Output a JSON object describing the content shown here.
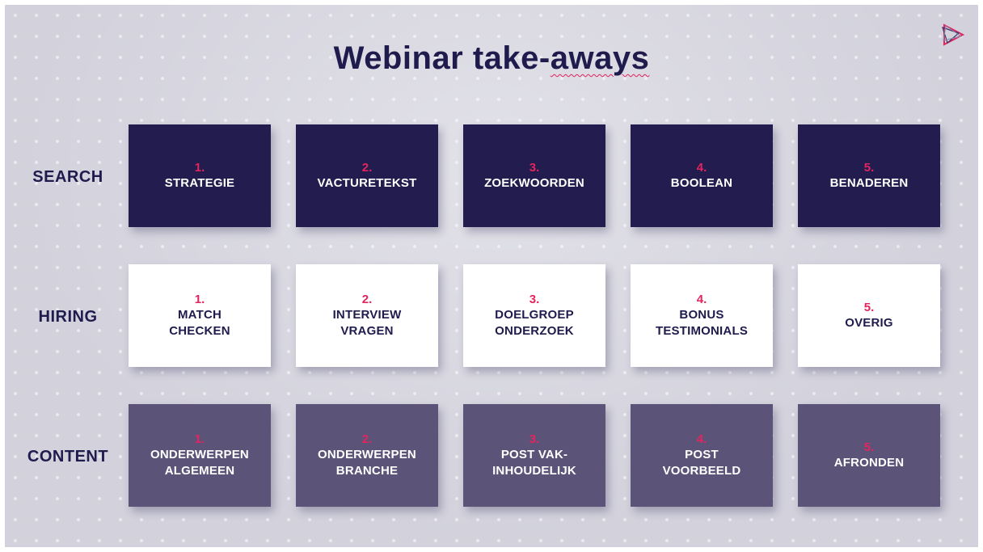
{
  "title": {
    "prefix": "Webinar take-",
    "underlined": "aways"
  },
  "logo_icon": "play-triangle-logo",
  "colors": {
    "accent": "#e4245e",
    "navy": "#221d4e",
    "muted": "#5b5478",
    "text": "#1f1b4d"
  },
  "rows": [
    {
      "label": "SEARCH",
      "cards": [
        {
          "num": "1.",
          "label": "STRATEGIE"
        },
        {
          "num": "2.",
          "label": "VACTURETEKST"
        },
        {
          "num": "3.",
          "label": "ZOEKWOORDEN"
        },
        {
          "num": "4.",
          "label": "BOOLEAN"
        },
        {
          "num": "5.",
          "label": "BENADEREN"
        }
      ]
    },
    {
      "label": "HIRING",
      "cards": [
        {
          "num": "1.",
          "label": "MATCH\nCHECKEN"
        },
        {
          "num": "2.",
          "label": "INTERVIEW\nVRAGEN"
        },
        {
          "num": "3.",
          "label": "DOELGROEP\nONDERZOEK"
        },
        {
          "num": "4.",
          "label": "BONUS\nTESTIMONIALS"
        },
        {
          "num": "5.",
          "label": "OVERIG"
        }
      ]
    },
    {
      "label": "CONTENT",
      "cards": [
        {
          "num": "1.",
          "label": "ONDERWERPEN\nALGEMEEN"
        },
        {
          "num": "2.",
          "label": "ONDERWERPEN\nBRANCHE"
        },
        {
          "num": "3.",
          "label": "POST VAK-\nINHOUDELIJK"
        },
        {
          "num": "4.",
          "label": "POST\nVOORBEELD"
        },
        {
          "num": "5.",
          "label": "AFRONDEN"
        }
      ]
    }
  ]
}
